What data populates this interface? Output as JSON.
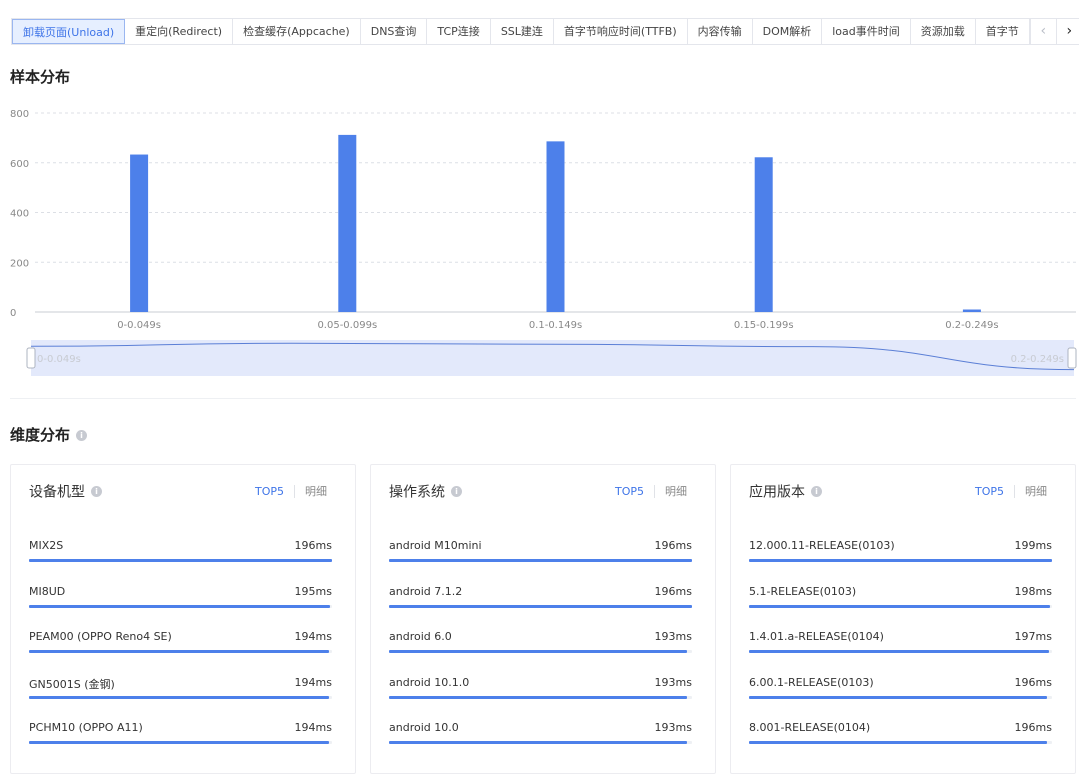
{
  "tabs": {
    "items": [
      {
        "label": "卸载页面(Unload)",
        "active": true
      },
      {
        "label": "重定向(Redirect)",
        "active": false
      },
      {
        "label": "检查缓存(Appcache)",
        "active": false
      },
      {
        "label": "DNS查询",
        "active": false
      },
      {
        "label": "TCP连接",
        "active": false
      },
      {
        "label": "SSL建连",
        "active": false
      },
      {
        "label": "首字节响应时间(TTFB)",
        "active": false
      },
      {
        "label": "内容传输",
        "active": false
      },
      {
        "label": "DOM解析",
        "active": false
      },
      {
        "label": "load事件时间",
        "active": false
      },
      {
        "label": "资源加载",
        "active": false
      },
      {
        "label": "首字节",
        "active": false
      }
    ],
    "prev_icon": "‹",
    "next_icon": "›"
  },
  "sample_section": {
    "title": "样本分布"
  },
  "dimension_section": {
    "title": "维度分布",
    "info_icon": "i"
  },
  "colors": {
    "accent": "#3e74e8",
    "bar": "#4d80ea",
    "zoom_fill": "#e3e9fb"
  },
  "chart_data": {
    "type": "bar",
    "categories": [
      "0-0.049s",
      "0.05-0.099s",
      "0.1-0.149s",
      "0.15-0.199s",
      "0.2-0.249s"
    ],
    "values": [
      633,
      712,
      686,
      622,
      10
    ],
    "ylim": [
      0,
      800
    ],
    "yticks": [
      0,
      200,
      400,
      600,
      800
    ],
    "grid": true,
    "zoom_slider": {
      "start_label": "0-0.049s",
      "end_label": "0.2-0.249s"
    }
  },
  "cards": [
    {
      "title": "设备机型",
      "info_icon": "i",
      "top5_label": "TOP5",
      "detail_label": "明细",
      "rows": [
        {
          "label": "MIX2S",
          "value": "196ms",
          "ratio": 1.0
        },
        {
          "label": "MI8UD",
          "value": "195ms",
          "ratio": 0.995
        },
        {
          "label": "PEAM00 (OPPO Reno4 SE)",
          "value": "194ms",
          "ratio": 0.99
        },
        {
          "label": "GN5001S (金钢)",
          "value": "194ms",
          "ratio": 0.99
        },
        {
          "label": "PCHM10 (OPPO A11)",
          "value": "194ms",
          "ratio": 0.99
        }
      ]
    },
    {
      "title": "操作系统",
      "info_icon": "i",
      "top5_label": "TOP5",
      "detail_label": "明细",
      "rows": [
        {
          "label": "android M10mini",
          "value": "196ms",
          "ratio": 1.0
        },
        {
          "label": "android 7.1.2",
          "value": "196ms",
          "ratio": 1.0
        },
        {
          "label": "android 6.0",
          "value": "193ms",
          "ratio": 0.985
        },
        {
          "label": "android 10.1.0",
          "value": "193ms",
          "ratio": 0.985
        },
        {
          "label": "android 10.0",
          "value": "193ms",
          "ratio": 0.985
        }
      ]
    },
    {
      "title": "应用版本",
      "info_icon": "i",
      "top5_label": "TOP5",
      "detail_label": "明细",
      "rows": [
        {
          "label": "12.000.11-RELEASE(0103)",
          "value": "199ms",
          "ratio": 1.0
        },
        {
          "label": "5.1-RELEASE(0103)",
          "value": "198ms",
          "ratio": 0.995
        },
        {
          "label": "1.4.01.a-RELEASE(0104)",
          "value": "197ms",
          "ratio": 0.99
        },
        {
          "label": "6.00.1-RELEASE(0103)",
          "value": "196ms",
          "ratio": 0.985
        },
        {
          "label": "8.001-RELEASE(0104)",
          "value": "196ms",
          "ratio": 0.985
        }
      ]
    }
  ]
}
